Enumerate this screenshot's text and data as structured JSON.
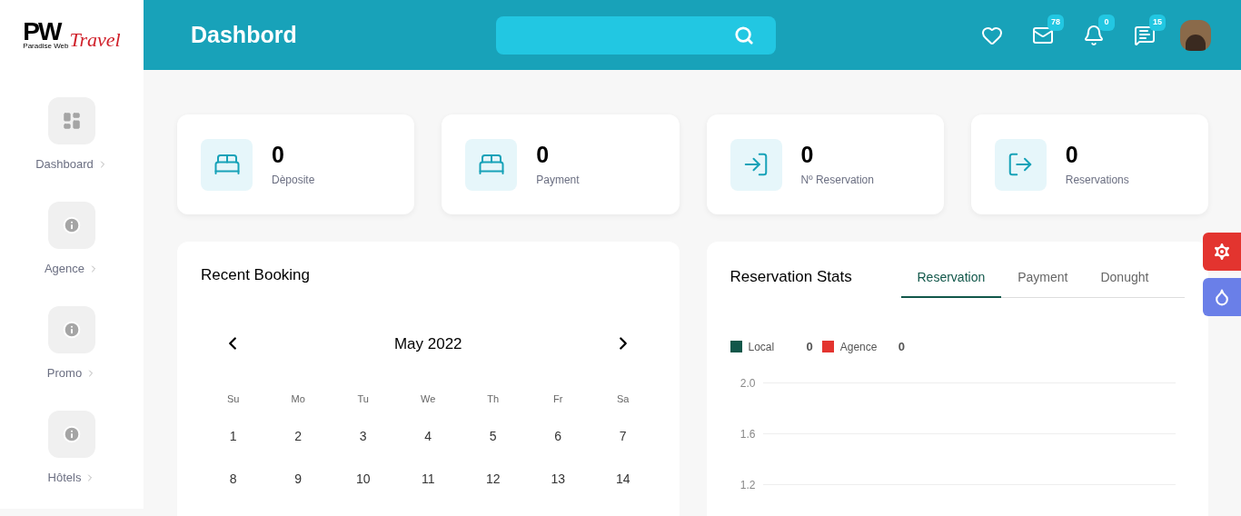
{
  "logo": {
    "letters": "PW",
    "tagline": "Paradise Web",
    "script": "Travel"
  },
  "header": {
    "title": "Dashbord",
    "icons": [
      {
        "kind": "heart"
      },
      {
        "kind": "mail",
        "badge": "78"
      },
      {
        "kind": "bell",
        "badge": "0"
      },
      {
        "kind": "chat",
        "badge": "15"
      },
      {
        "kind": "avatar"
      }
    ]
  },
  "sidebar": {
    "items": [
      {
        "kind": "dashboard",
        "label": "Dashboard"
      },
      {
        "kind": "info",
        "label": "Agence"
      },
      {
        "kind": "info",
        "label": "Promo"
      },
      {
        "kind": "info",
        "label": "Hôtels"
      }
    ]
  },
  "stats": [
    {
      "kind": "bed",
      "value": "0",
      "label": "Dèposite"
    },
    {
      "kind": "bed",
      "value": "0",
      "label": "Payment"
    },
    {
      "kind": "enter",
      "value": "0",
      "label": "Nº Reservation"
    },
    {
      "kind": "exit",
      "value": "0",
      "label": "Reservations"
    }
  ],
  "recent_booking": {
    "title": "Recent Booking",
    "month": "May 2022",
    "weekdays": [
      "Su",
      "Mo",
      "Tu",
      "We",
      "Th",
      "Fr",
      "Sa"
    ],
    "weeks": [
      [
        "1",
        "2",
        "3",
        "4",
        "5",
        "6",
        "7"
      ],
      [
        "8",
        "9",
        "10",
        "11",
        "12",
        "13",
        "14"
      ]
    ]
  },
  "reservation_stats": {
    "title": "Reservation Stats",
    "tabs": [
      {
        "label": "Reservation",
        "selected": true
      },
      {
        "label": "Payment",
        "selected": false
      },
      {
        "label": "Donught",
        "selected": false
      }
    ],
    "legend": [
      {
        "label": "Local",
        "value": "0",
        "color": "#11574a"
      },
      {
        "label": "Agence",
        "value": "0",
        "color": "#e3342f"
      }
    ],
    "axis_labels": [
      "2.0",
      "1.6",
      "1.2"
    ]
  },
  "floating_buttons": [
    {
      "kind": "settings"
    },
    {
      "kind": "theme"
    }
  ]
}
